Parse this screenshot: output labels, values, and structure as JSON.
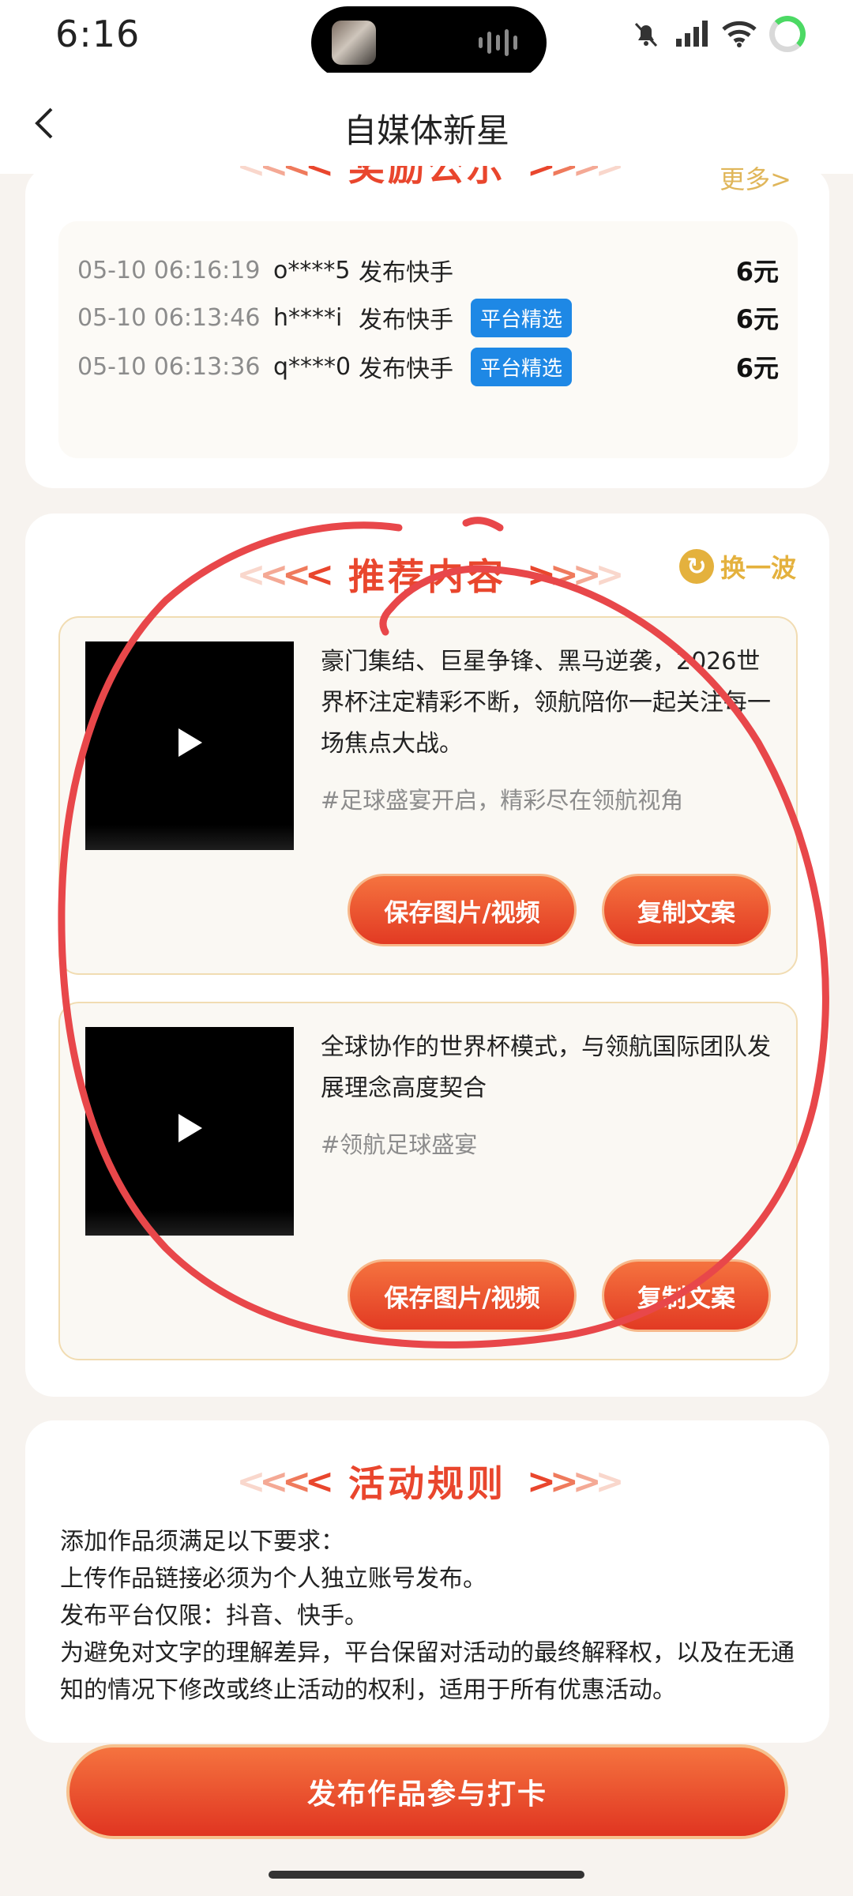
{
  "status_bar": {
    "time": "6:16"
  },
  "nav": {
    "title": "自媒体新星"
  },
  "winners": {
    "section_title": "奖励公示",
    "more_label": "更多>",
    "rows": [
      {
        "time": "05-10 06:16:19",
        "user": "o****5",
        "desc": "发布快手",
        "tag": "",
        "amount": "6元"
      },
      {
        "time": "05-10 06:13:46",
        "user": "h****i",
        "desc": "发布快手",
        "tag": "平台精选",
        "amount": "6元"
      },
      {
        "time": "05-10 06:13:36",
        "user": "q****0",
        "desc": "发布快手",
        "tag": "平台精选",
        "amount": "6元"
      }
    ]
  },
  "recommend": {
    "section_title": "推荐内容",
    "swap_label": "换一波",
    "posts": [
      {
        "text": "豪门集结、巨星争锋、黑马逆袭，2026世界杯注定精彩不断，领航陪你一起关注每一场焦点大战。",
        "tag": "#足球盛宴开启，精彩尽在领航视角",
        "save_label": "保存图片/视频",
        "copy_label": "复制文案"
      },
      {
        "text": "全球协作的世界杯模式，与领航国际团队发展理念高度契合",
        "tag": "#领航足球盛宴",
        "save_label": "保存图片/视频",
        "copy_label": "复制文案"
      }
    ]
  },
  "rules": {
    "section_title": "活动规则",
    "lines": [
      "添加作品须满足以下要求：",
      "上传作品链接必须为个人独立账号发布。",
      "发布平台仅限：抖音、快手。",
      "为避免对文字的理解差异，平台保留对活动的最终解释权，以及在无通知的情况下修改或终止活动的权利，适用于所有优惠活动。"
    ]
  },
  "cta": {
    "label": "发布作品参与打卡"
  },
  "colors": {
    "accent": "#e9462d",
    "gold": "#e4b13d",
    "tag_blue": "#1e88e5",
    "scribble": "#e8474a"
  }
}
